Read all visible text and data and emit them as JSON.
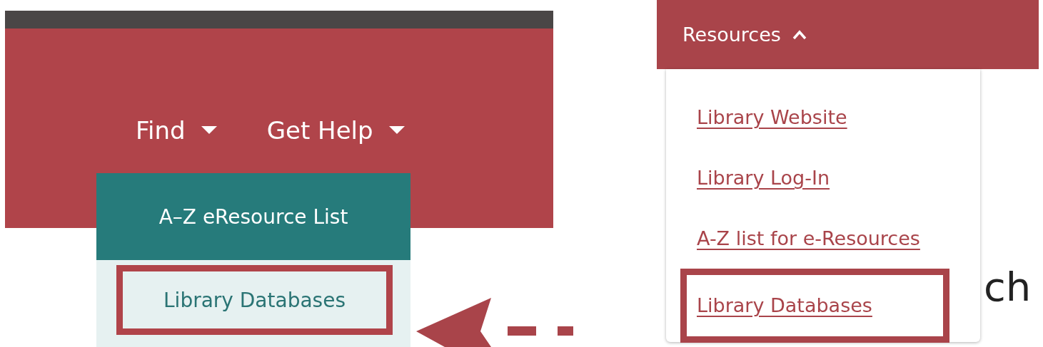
{
  "left_screenshot": {
    "nav_items": [
      {
        "label": "Find"
      },
      {
        "label": "Get Help"
      }
    ],
    "dropdown": {
      "header": "A–Z eResource List",
      "items": [
        {
          "label": "Library Databases",
          "highlighted": true
        }
      ]
    }
  },
  "right_screenshot": {
    "menu": {
      "label": "Resources",
      "expanded": true
    },
    "items": [
      {
        "label": "Library Website",
        "highlighted": false
      },
      {
        "label": "Library Log-In",
        "highlighted": false
      },
      {
        "label": "A-Z list for e-Resources",
        "highlighted": false
      },
      {
        "label": "Library Databases",
        "highlighted": true
      }
    ],
    "background_text": "ch"
  }
}
